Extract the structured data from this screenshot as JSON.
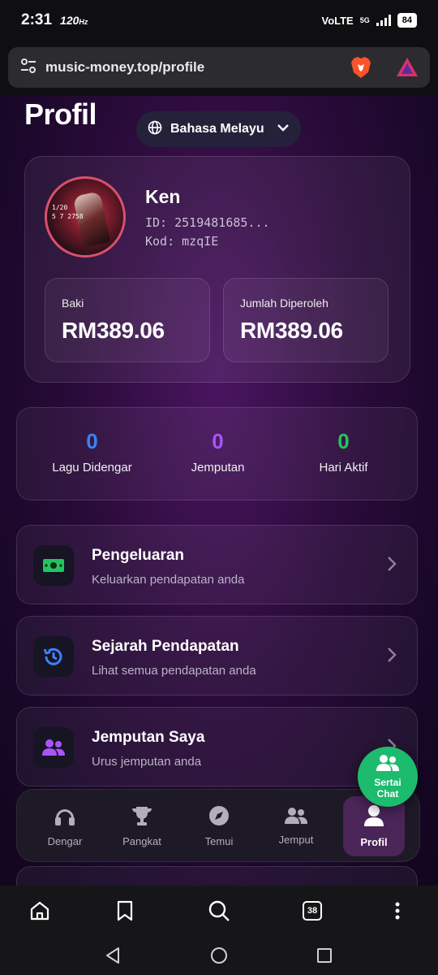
{
  "status": {
    "time": "2:31",
    "refresh": "120",
    "network": "VoLTE",
    "net_type": "5G",
    "battery": "84"
  },
  "browser": {
    "url": "music-money.top/profile",
    "tab_count": "38"
  },
  "page": {
    "title": "Profil",
    "language": "Bahasa Melayu"
  },
  "profile": {
    "name": "Ken",
    "id_text": "ID: 2519481685...",
    "code_text": "Kod: mzqIE",
    "avatar_hud": [
      "1/20",
      "5  7   2758"
    ]
  },
  "balances": [
    {
      "label": "Baki",
      "value": "RM389.06"
    },
    {
      "label": "Jumlah Diperoleh",
      "value": "RM389.06"
    }
  ],
  "stats": [
    {
      "value": "0",
      "label": "Lagu Didengar",
      "color": "#3b82f6"
    },
    {
      "value": "0",
      "label": "Jemputan",
      "color": "#a855f7"
    },
    {
      "value": "0",
      "label": "Hari Aktif",
      "color": "#22c55e"
    }
  ],
  "menu": [
    {
      "title": "Pengeluaran",
      "subtitle": "Keluarkan pendapatan anda",
      "icon": "cash-icon",
      "icon_color": "#22c55e"
    },
    {
      "title": "Sejarah Pendapatan",
      "subtitle": "Lihat semua pendapatan anda",
      "icon": "history-icon",
      "icon_color": "#3b82f6"
    },
    {
      "title": "Jemputan Saya",
      "subtitle": "Urus jemputan anda",
      "icon": "users-icon",
      "icon_color": "#a855f7"
    }
  ],
  "chat": {
    "line1": "Sertai",
    "line2": "Chat"
  },
  "nav": [
    {
      "label": "Dengar",
      "icon": "headphones-icon"
    },
    {
      "label": "Pangkat",
      "icon": "trophy-icon"
    },
    {
      "label": "Temui",
      "icon": "compass-icon"
    },
    {
      "label": "Jemput",
      "icon": "users-icon"
    },
    {
      "label": "Profil",
      "icon": "user-icon",
      "active": true
    }
  ]
}
